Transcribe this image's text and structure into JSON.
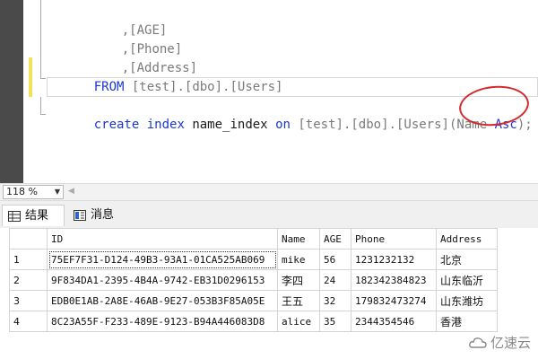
{
  "editor": {
    "lines": [
      {
        "col": ",",
        "id": "[AGE]"
      },
      {
        "col": ",",
        "id": "[Phone]"
      },
      {
        "col": ",",
        "id": "[Address]"
      }
    ],
    "from_kw": "FROM",
    "from_db": "[test]",
    "from_schema": "[dbo]",
    "from_table": "[Users]",
    "create_kw": "create",
    "index_kw": "index",
    "index_name": "name_index",
    "on_kw": "on",
    "idx_db": "[test]",
    "idx_schema": "[dbo]",
    "idx_table": "[Users]",
    "open_paren": "(",
    "col_name": "Name",
    "asc_kw": "Asc",
    "close": ");"
  },
  "zoom": {
    "value": "118 %"
  },
  "tabs": [
    {
      "label": "结果",
      "icon": "grid-icon",
      "active": true
    },
    {
      "label": "消息",
      "icon": "message-icon",
      "active": false
    }
  ],
  "results": {
    "columns": [
      "ID",
      "Name",
      "AGE",
      "Phone",
      "Address"
    ],
    "rows": [
      {
        "num": "1",
        "cells": [
          "75EF7F31-D124-49B3-93A1-01CA525AB069",
          "mike",
          "56",
          "1231232132",
          "北京"
        ]
      },
      {
        "num": "2",
        "cells": [
          "9F834DA1-2395-4B4A-9742-EB31D0296153",
          "李四",
          "24",
          "182342384823",
          "山东临沂"
        ]
      },
      {
        "num": "3",
        "cells": [
          "EDB0E1AB-2A8E-46AB-9E27-053B3F85A05E",
          "王五",
          "32",
          "179832473274",
          "山东潍坊"
        ]
      },
      {
        "num": "4",
        "cells": [
          "8C23A55F-F233-489E-9123-B94A446083D8",
          "alice",
          "35",
          "2344354546",
          "香港"
        ]
      }
    ]
  },
  "watermark": {
    "text": "亿速云"
  },
  "colors": {
    "keyword": "#1a38d8",
    "highlight_circle": "#d42a2a",
    "change_bar": "#f0e35a"
  }
}
